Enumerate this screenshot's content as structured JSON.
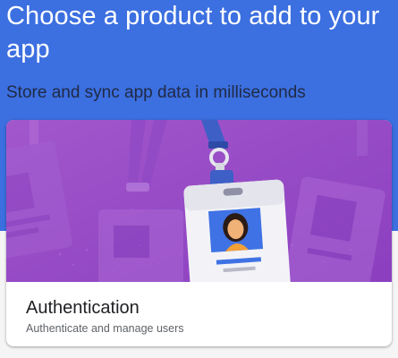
{
  "header": {
    "title": "Choose a product to add to your app",
    "subtitle": "Store and sync app data in milliseconds",
    "background_color": "#3c6fe0"
  },
  "product_card": {
    "illustration": "id-badge-lanyard-illustration",
    "title": "Authentication",
    "description": "Authenticate and manage users",
    "accent_color": "#9b4fc8"
  }
}
